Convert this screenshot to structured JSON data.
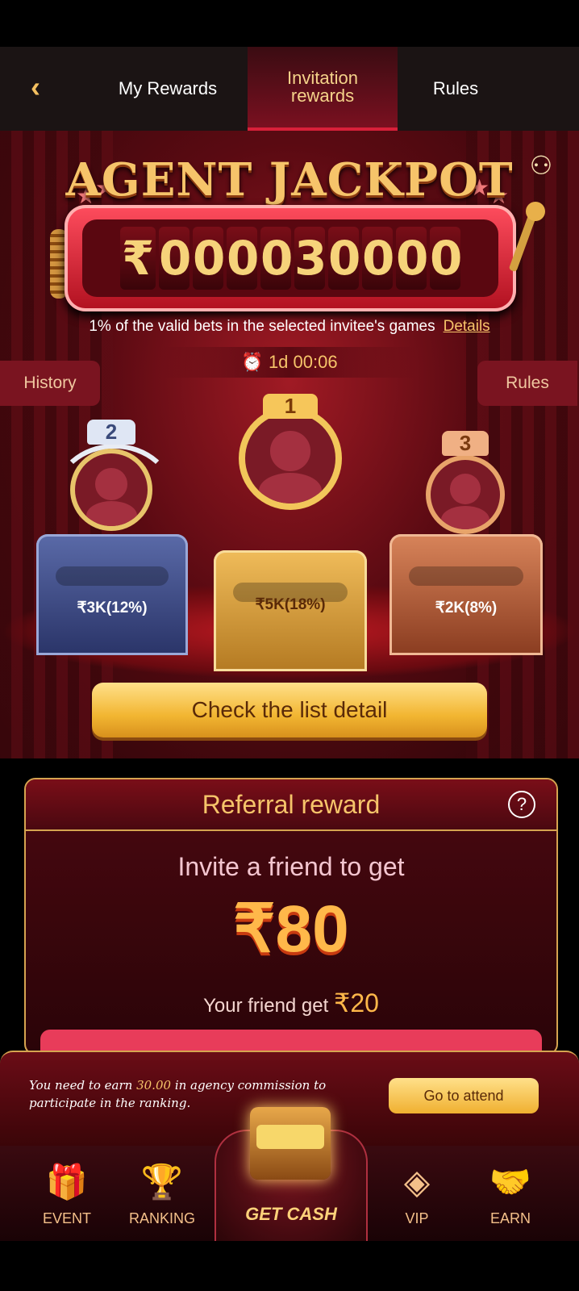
{
  "header": {
    "tabs": [
      {
        "label": "My Rewards",
        "active": false
      },
      {
        "label": "Invitation rewards",
        "active": true
      },
      {
        "label": "Rules",
        "active": false
      }
    ]
  },
  "jackpot": {
    "title": "AGENT JACKPOT",
    "currency": "₹",
    "digits": [
      "0",
      "0",
      "0",
      "0",
      "3",
      "0",
      "0",
      "0",
      "0"
    ],
    "description": "1% of the valid bets in the selected invitee's games",
    "details_link": "Details",
    "timer": "1d 00:06",
    "history_button": "History",
    "rules_button": "Rules"
  },
  "podium": [
    {
      "rank": "2",
      "amount": "₹3K(12%)"
    },
    {
      "rank": "1",
      "amount": "₹5K(18%)"
    },
    {
      "rank": "3",
      "amount": "₹2K(8%)"
    }
  ],
  "check_list_button": "Check the list detail",
  "referral": {
    "title": "Referral reward",
    "invite_text": "Invite a friend to get",
    "amount": "₹80",
    "friend_text": "Your friend get",
    "friend_amount": "₹20"
  },
  "notice": {
    "text_before": "You need to earn ",
    "highlight": "30.00",
    "text_after": " in agency commission to participate in the ranking.",
    "button": "Go to attend"
  },
  "nav": {
    "event": "EVENT",
    "ranking": "RANKING",
    "get_cash": "GET CASH",
    "vip": "VIP",
    "earn": "EARN"
  },
  "colors": {
    "gold": "#f6c46a",
    "maroon": "#5a0a12",
    "accent_red": "#d8203a"
  }
}
